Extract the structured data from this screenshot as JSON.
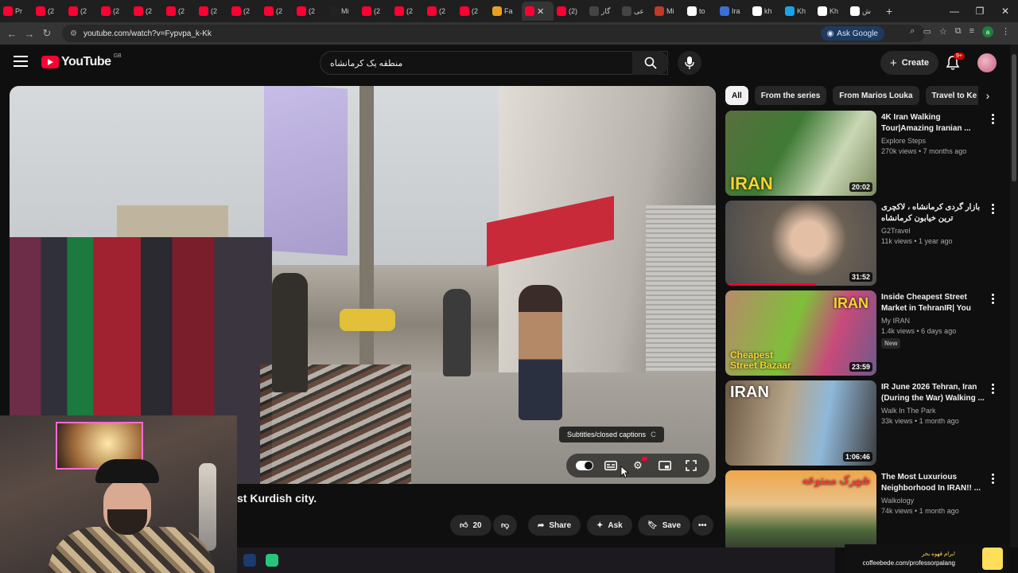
{
  "browser": {
    "tabs": [
      {
        "label": "Pr",
        "favicon_color": "#ff0033"
      },
      {
        "label": "(2",
        "favicon_color": "#ff0033"
      },
      {
        "label": "(2",
        "favicon_color": "#ff0033"
      },
      {
        "label": "(2",
        "favicon_color": "#ff0033"
      },
      {
        "label": "(2",
        "favicon_color": "#ff0033"
      },
      {
        "label": "(2",
        "favicon_color": "#ff0033"
      },
      {
        "label": "(2",
        "favicon_color": "#ff0033"
      },
      {
        "label": "(2",
        "favicon_color": "#ff0033"
      },
      {
        "label": "(2",
        "favicon_color": "#ff0033"
      },
      {
        "label": "(2",
        "favicon_color": "#ff0033"
      },
      {
        "label": "Mi",
        "favicon_color": "#222222"
      },
      {
        "label": "(2",
        "favicon_color": "#ff0033"
      },
      {
        "label": "(2",
        "favicon_color": "#ff0033"
      },
      {
        "label": "(2",
        "favicon_color": "#ff0033"
      },
      {
        "label": "(2",
        "favicon_color": "#ff0033"
      },
      {
        "label": "Fa",
        "favicon_color": "#e8a020"
      }
    ],
    "active_tab_close": "✕",
    "after_tabs": [
      {
        "label": "(2)",
        "favicon_color": "#ff0033"
      },
      {
        "label": "گار",
        "favicon_color": "#444444"
      },
      {
        "label": "عی",
        "favicon_color": "#444444"
      },
      {
        "label": "Mi",
        "favicon_color": "#c0392b"
      },
      {
        "label": "to",
        "favicon_color": "#ffffff"
      },
      {
        "label": "Ira",
        "favicon_color": "#3b6fd6"
      },
      {
        "label": "kh",
        "favicon_color": "#ffffff"
      },
      {
        "label": "Kh",
        "favicon_color": "#1aa3e8"
      },
      {
        "label": "Kh",
        "favicon_color": "#ffffff"
      },
      {
        "label": "ش",
        "favicon_color": "#ffffff"
      }
    ],
    "new_tab": "+",
    "window_controls": [
      "—",
      "❐",
      "✕"
    ],
    "url": "youtube.com/watch?v=Fypvpa_k-Kk",
    "ask_google": "Ask Google",
    "profile_letter": "a"
  },
  "header": {
    "logo_text": "YouTube",
    "country_code": "GB",
    "search_query": "منطقه یک کرمانشاه",
    "create_label": "Create",
    "notifications_badge": "9+"
  },
  "player": {
    "tooltip_label": "Subtitles/closed captions",
    "tooltip_key": "C"
  },
  "video": {
    "title_visible": "st Kurdish city.",
    "like_count": "20",
    "share_label": "Share",
    "ask_label": "Ask",
    "save_label": "Save"
  },
  "chips": [
    "All",
    "From the series",
    "From Marios Louka",
    "Travel to Ke"
  ],
  "recommendations": [
    {
      "title": "4K Iran Walking Tour|Amazing Iranian ...",
      "channel": "Explore Steps",
      "meta": "270k views • 7 months ago",
      "duration": "20:02",
      "thumb_caption": "IRAN",
      "rtl": false,
      "badge": ""
    },
    {
      "title": "بازار گردی کرمانشاه ، لاکچری ترین خیابون کرمانشاه",
      "channel": "G2Travel",
      "meta": "11k views • 1 year ago",
      "duration": "31:52",
      "thumb_caption": "",
      "rtl": true,
      "badge": ""
    },
    {
      "title": "Inside Cheapest Street Market in TehranIR| You Ca...",
      "channel": "My IRAN",
      "meta": "1.4k views • 6 days ago",
      "duration": "23:59",
      "thumb_caption": "Cheapest Street Bazaar",
      "rtl": false,
      "badge": "New"
    },
    {
      "title": "IR June 2026 Tehran, Iran (During the War) Walking ...",
      "channel": "Walk In The Park",
      "meta": "33k views • 1 month ago",
      "duration": "1:06:46",
      "thumb_caption": "IRAN",
      "rtl": false,
      "badge": ""
    },
    {
      "title": "The Most Luxurious Neighborhood In IRAN!! ...",
      "channel": "Walkology",
      "meta": "74k views • 1 month ago",
      "duration": "",
      "thumb_caption": "شهرک ممنوعه",
      "rtl": false,
      "badge": ""
    }
  ],
  "promo": {
    "headline": "برام قهوه بخر!",
    "url": "coffeebede.com/professorpalang"
  }
}
